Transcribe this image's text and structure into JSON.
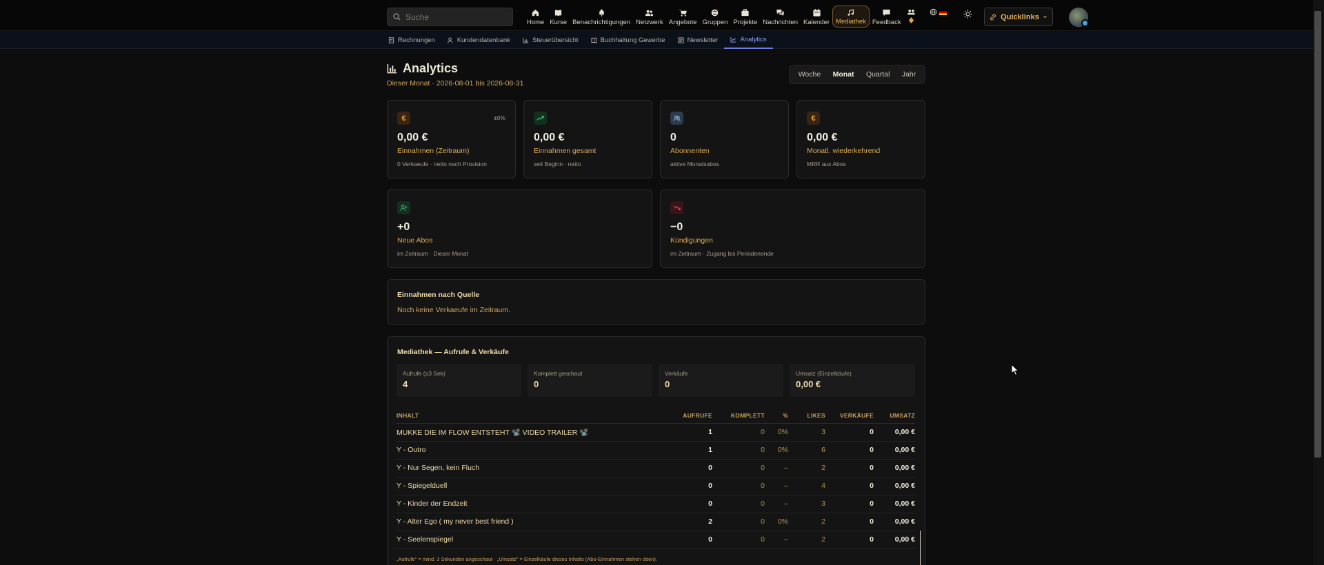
{
  "search": {
    "placeholder": "Suche"
  },
  "nav": [
    {
      "label": "Home",
      "icon": "home-icon"
    },
    {
      "label": "Kurse",
      "icon": "book-icon"
    },
    {
      "label": "Benachrichtigungen",
      "icon": "bell-icon"
    },
    {
      "label": "Netzwerk",
      "icon": "users-icon"
    },
    {
      "label": "Angebote",
      "icon": "cart-icon"
    },
    {
      "label": "Gruppen",
      "icon": "globe-icon"
    },
    {
      "label": "Projekte",
      "icon": "briefcase-icon"
    },
    {
      "label": "Nachrichten",
      "icon": "chat-icon"
    },
    {
      "label": "Kalender",
      "icon": "calendar-icon"
    },
    {
      "label": "Mediathek",
      "icon": "music-icon",
      "active": true
    },
    {
      "label": "Feedback",
      "icon": "message-icon"
    }
  ],
  "quicklinks": "Quicklinks",
  "subnav": [
    {
      "label": "Rechnungen",
      "icon": "file-icon"
    },
    {
      "label": "Kundendatenbank",
      "icon": "user-icon"
    },
    {
      "label": "Steuerübersicht",
      "icon": "bar-chart-icon"
    },
    {
      "label": "Buchhaltung Gewerbe",
      "icon": "ledger-icon"
    },
    {
      "label": "Newsletter",
      "icon": "newsletter-icon"
    },
    {
      "label": "Analytics",
      "icon": "line-chart-icon",
      "active": true
    }
  ],
  "page": {
    "title": "Analytics",
    "subtitle": "Dieser Monat · 2026-08-01 bis 2026-08-31",
    "periods": [
      "Woche",
      "Monat",
      "Quartal",
      "Jahr"
    ],
    "active_period": "Monat"
  },
  "cards": [
    {
      "value": "0,00 €",
      "label": "Einnahmen (Zeitraum)",
      "sub": "0 Verkaeufe · netto nach Provision",
      "delta": "±0%",
      "icon": "euro-icon"
    },
    {
      "value": "0,00 €",
      "label": "Einnahmen gesamt",
      "sub": "seit Beginn · netto",
      "icon": "trend-up-icon"
    },
    {
      "value": "0",
      "label": "Abonnenten",
      "sub": "aktive Monatsabos",
      "icon": "users-icon"
    },
    {
      "value": "0,00 €",
      "label": "Monatl. wiederkehrend",
      "sub": "MRR aus Abos",
      "icon": "euro-icon"
    },
    {
      "value": "+0",
      "label": "Neue Abos",
      "sub": "im Zeitraum · Dieser Monat",
      "icon": "user-plus-icon"
    },
    {
      "value": "−0",
      "label": "Kündigungen",
      "sub": "im Zeitraum · Zugang bis Periodenende",
      "icon": "trend-down-icon"
    }
  ],
  "source": {
    "title": "Einnahmen nach Quelle",
    "empty": "Noch keine Verkaeufe im Zeitraum."
  },
  "media": {
    "title": "Mediathek — Aufrufe & Verkäufe",
    "stats": [
      {
        "label": "Aufrufe (≥3 Sek)",
        "value": "4"
      },
      {
        "label": "Komplett geschaut",
        "value": "0"
      },
      {
        "label": "Verkäufe",
        "value": "0"
      },
      {
        "label": "Umsatz (Einzelkäufe)",
        "value": "0,00 €"
      }
    ],
    "columns": [
      "INHALT",
      "AUFRUFE",
      "KOMPLETT",
      "%",
      "LIKES",
      "VERKÄUFE",
      "UMSATZ"
    ],
    "rows": [
      [
        "MUKKE DIE IM FLOW ENTSTEHT 📽️ VIDEO TRAILER 📽️",
        "1",
        "0",
        "0%",
        "3",
        "0",
        "0,00 €"
      ],
      [
        "Y - Outro",
        "1",
        "0",
        "0%",
        "6",
        "0",
        "0,00 €"
      ],
      [
        "Y - Nur Segen, kein Fluch",
        "0",
        "0",
        "–",
        "2",
        "0",
        "0,00 €"
      ],
      [
        "Y - Spiegelduell",
        "0",
        "0",
        "–",
        "4",
        "0",
        "0,00 €"
      ],
      [
        "Y - Kinder der Endzeit",
        "0",
        "0",
        "–",
        "3",
        "0",
        "0,00 €"
      ],
      [
        "Y - Alter Ego ( my never best friend )",
        "2",
        "0",
        "0%",
        "2",
        "0",
        "0,00 €"
      ],
      [
        "Y - Seelenspiegel",
        "0",
        "0",
        "–",
        "2",
        "0",
        "0,00 €"
      ]
    ],
    "footnote": "„Aufrufe\" = mind. 3 Sekunden angeschaut · „Umsatz\" = Einzelkäufe dieses Inhalts (Abo-Einnahmen stehen oben)."
  }
}
